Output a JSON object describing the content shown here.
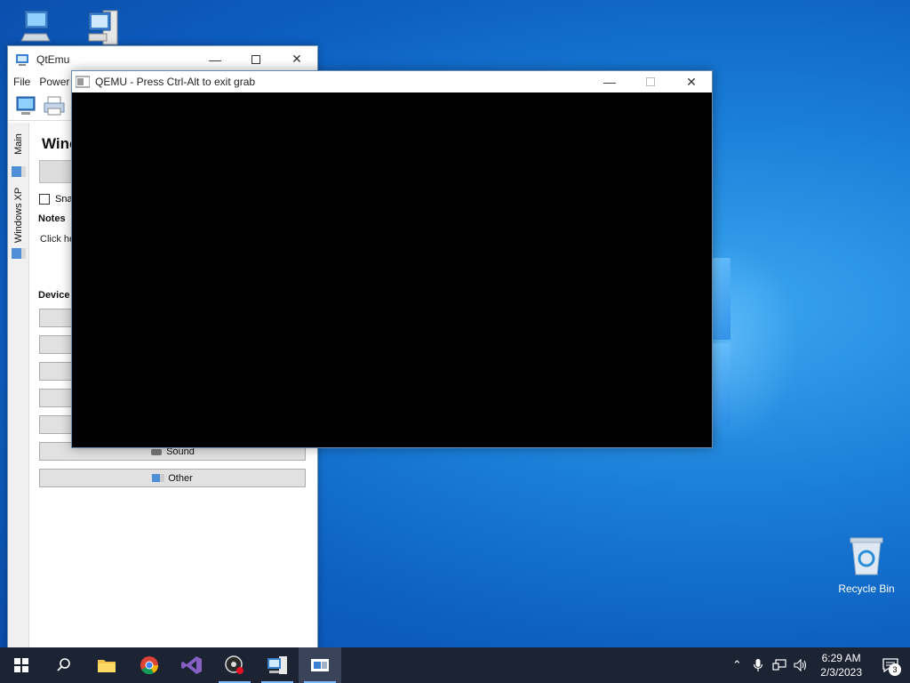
{
  "desktop": {
    "recycle_bin_label": "Recycle Bin"
  },
  "qtemu": {
    "title": "QtEmu",
    "menu": [
      "File",
      "Power"
    ],
    "tabs": [
      "Main",
      "Windows XP"
    ],
    "vm_title": "Winc",
    "snapshot_label": "Sna",
    "notes_heading": "Notes",
    "notes_text": "Click he",
    "devices_heading": "Device",
    "devices": [
      "",
      "",
      "",
      "",
      "",
      "Sound",
      "Other"
    ]
  },
  "qemu": {
    "title": "QEMU - Press Ctrl-Alt to exit grab"
  },
  "taskbar": {
    "time": "6:29 AM",
    "date": "2/3/2023",
    "notification_count": "3"
  },
  "colors": {
    "desktop_blue": "#1a7fd8",
    "taskbar": "#1c2434",
    "qemu_screen": "#000000"
  }
}
